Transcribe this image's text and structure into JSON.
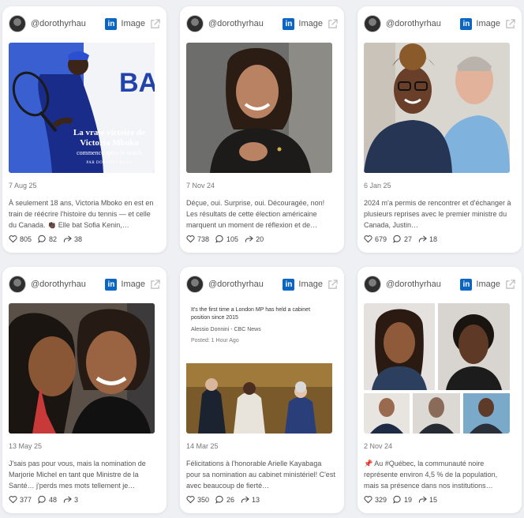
{
  "posts": [
    {
      "handle": "@dorothyrhau",
      "type_label": "Image",
      "image": "tennis-player-photo",
      "image_caption": {
        "title": "La vraie victoire de Victoria Mboko",
        "subtitle": "commence après le match",
        "byline": "PAR DOROTHY RHAU"
      },
      "date": "7 Aug 25",
      "text": "À seulement 18 ans, Victoria Mboko en est en train de réécrire l'histoire du tennis — et celle du Canada. 👏🏿 Elle bat Sofia Kenin,…",
      "likes": "805",
      "comments": "82",
      "shares": "38"
    },
    {
      "handle": "@dorothyrhau",
      "type_label": "Image",
      "image": "woman-portrait-photo",
      "date": "7 Nov 24",
      "text": "Déçue, oui. Surprise, oui. Découragée, non! Les résultats de cette élection américaine marquent un moment de réflexion et de…",
      "likes": "738",
      "comments": "105",
      "shares": "20"
    },
    {
      "handle": "@dorothyrhau",
      "type_label": "Image",
      "image": "two-people-selfie-photo",
      "date": "6 Jan 25",
      "text": "2024 m'a permis de rencontrer et d'échanger à plusieurs reprises avec le premier ministre du Canada, Justin…",
      "likes": "679",
      "comments": "27",
      "shares": "18"
    },
    {
      "handle": "@dorothyrhau",
      "type_label": "Image",
      "image": "two-women-photo",
      "date": "13 May 25",
      "text": "J'sais pas pour vous, mais la nomination de Marjorie Michel en tant que Ministre de la Santé… j'perds mes mots tellement je…",
      "likes": "377",
      "comments": "48",
      "shares": "3"
    },
    {
      "handle": "@dorothyrhau",
      "type_label": "Image",
      "image": "news-screenshot-photo",
      "news": {
        "headline": "It's the first time a London MP has held a cabinet position since 2015",
        "author": "Alessio Donnini - CBC News",
        "posted": "Posted: 1 Hour Ago"
      },
      "date": "14 Mar 25",
      "text": "Félicitations à l'honorable Arielle Kayabaga pour sa nomination au cabinet ministériel! C'est avec beaucoup de fierté…",
      "likes": "350",
      "comments": "26",
      "shares": "13"
    },
    {
      "handle": "@dorothyrhau",
      "type_label": "Image",
      "image": "portrait-collage-photo",
      "date": "2 Nov 24",
      "text": "📌 Au #Québec, la communauté noire représente environ 4,5 % de la population, mais sa présence dans nos institutions…",
      "likes": "329",
      "comments": "19",
      "shares": "15"
    }
  ],
  "icons": {
    "brand": "linkedin-icon",
    "external": "external-link-icon",
    "like": "heart-icon",
    "comment": "comment-icon",
    "share": "share-icon"
  },
  "colors": {
    "linkedin": "#0a66c2",
    "background": "#eef0f4"
  }
}
